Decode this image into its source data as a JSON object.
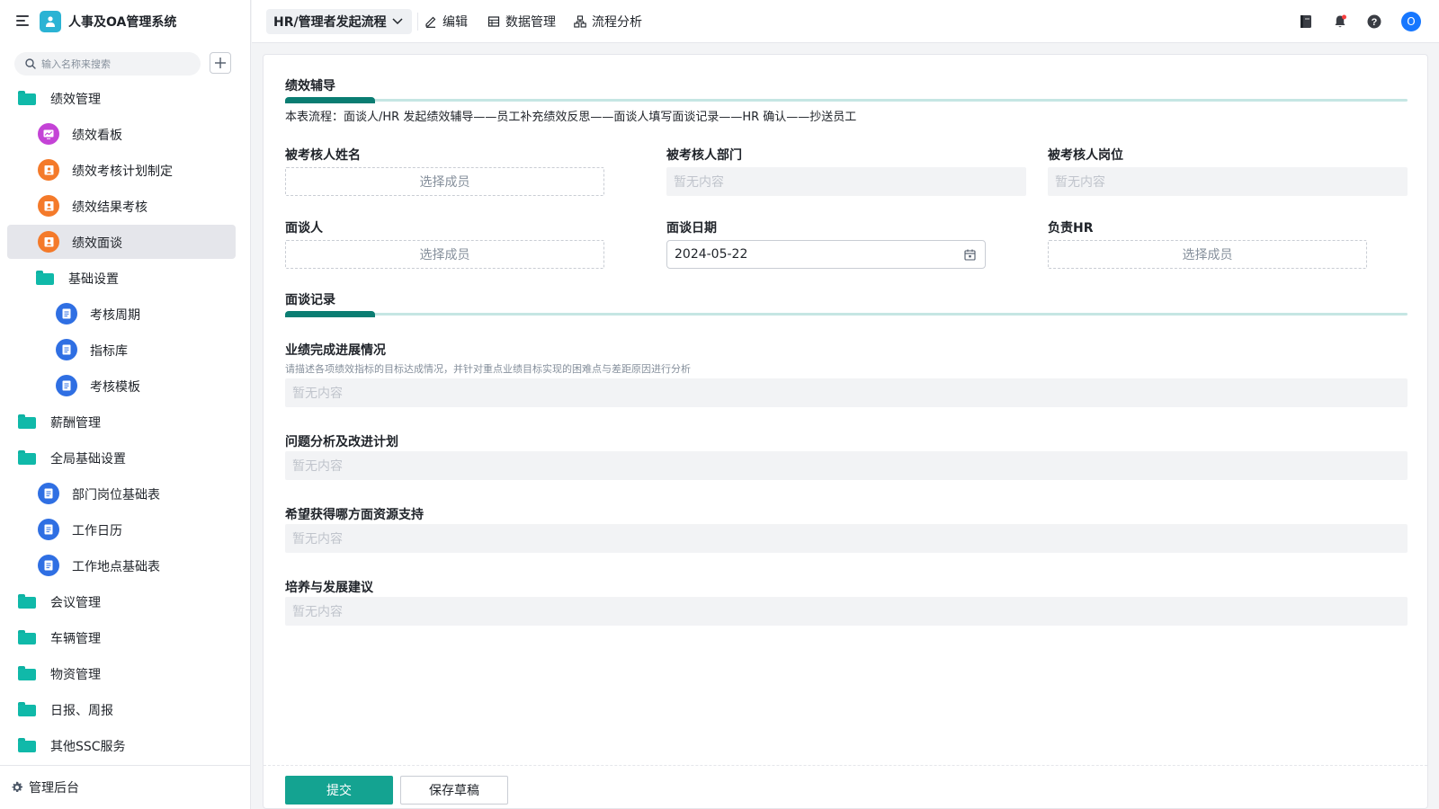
{
  "app": {
    "title": "人事及OA管理系统"
  },
  "search": {
    "placeholder": "输入名称来搜索"
  },
  "sidebar": {
    "items": [
      {
        "label": "绩效管理",
        "type": "folder",
        "active": false
      },
      {
        "label": "绩效看板",
        "type": "dashboard",
        "color": "#c443d6",
        "active": false
      },
      {
        "label": "绩效考核计划制定",
        "type": "form",
        "color": "#f47a2a",
        "active": false
      },
      {
        "label": "绩效结果考核",
        "type": "form",
        "color": "#f47a2a",
        "active": false
      },
      {
        "label": "绩效面谈",
        "type": "form",
        "color": "#f47a2a",
        "active": true
      },
      {
        "label": "基础设置",
        "type": "folder",
        "active": false
      },
      {
        "label": "考核周期",
        "type": "doc",
        "color": "#2f6fe3",
        "active": false
      },
      {
        "label": "指标库",
        "type": "doc",
        "color": "#2f6fe3",
        "active": false
      },
      {
        "label": "考核模板",
        "type": "doc",
        "color": "#2f6fe3",
        "active": false
      },
      {
        "label": "薪酬管理",
        "type": "folder",
        "active": false
      },
      {
        "label": "全局基础设置",
        "type": "folder",
        "active": false
      },
      {
        "label": "部门岗位基础表",
        "type": "doc",
        "color": "#2f6fe3",
        "active": false
      },
      {
        "label": "工作日历",
        "type": "doc",
        "color": "#2f6fe3",
        "active": false
      },
      {
        "label": "工作地点基础表",
        "type": "doc",
        "color": "#2f6fe3",
        "active": false
      },
      {
        "label": "会议管理",
        "type": "folder",
        "active": false
      },
      {
        "label": "车辆管理",
        "type": "folder",
        "active": false
      },
      {
        "label": "物资管理",
        "type": "folder",
        "active": false
      },
      {
        "label": "日报、周报",
        "type": "folder",
        "active": false
      },
      {
        "label": "其他SSC服务",
        "type": "folder",
        "active": false
      }
    ],
    "footer_label": "管理后台"
  },
  "topbar": {
    "flow_selector": "HR/管理者发起流程",
    "edit_label": "编辑",
    "data_label": "数据管理",
    "analysis_label": "流程分析",
    "avatar_initial": "O"
  },
  "form": {
    "section1_title": "绩效辅导",
    "flow_description": "本表流程：面谈人/HR 发起绩效辅导——员工补充绩效反思——面谈人填写面谈记录——HR 确认——抄送员工",
    "fields": {
      "employee_name": {
        "label": "被考核人姓名",
        "value": "选择成员"
      },
      "department": {
        "label": "被考核人部门",
        "value": "暂无内容"
      },
      "position": {
        "label": "被考核人岗位",
        "value": "暂无内容"
      },
      "interviewer": {
        "label": "面谈人",
        "value": "选择成员"
      },
      "interview_date": {
        "label": "面谈日期",
        "value": "2024-05-22"
      },
      "hr": {
        "label": "负责HR",
        "value": "选择成员"
      }
    },
    "section2_title": "面谈记录",
    "records": {
      "progress": {
        "label": "业绩完成进展情况",
        "hint": "请描述各项绩效指标的目标达成情况，并针对重点业绩目标实现的困难点与差距原因进行分析",
        "value": "暂无内容"
      },
      "analysis": {
        "label": "问题分析及改进计划",
        "value": "暂无内容"
      },
      "support": {
        "label": "希望获得哪方面资源支持",
        "value": "暂无内容"
      },
      "development": {
        "label": "培养与发展建议",
        "value": "暂无内容"
      }
    }
  },
  "actions": {
    "submit_label": "提交",
    "draft_label": "保存草稿"
  },
  "colors": {
    "accent": "#14a391",
    "section_bar": "#0a7d72",
    "folder": "#10b9a9",
    "avatar": "#1677ff"
  }
}
